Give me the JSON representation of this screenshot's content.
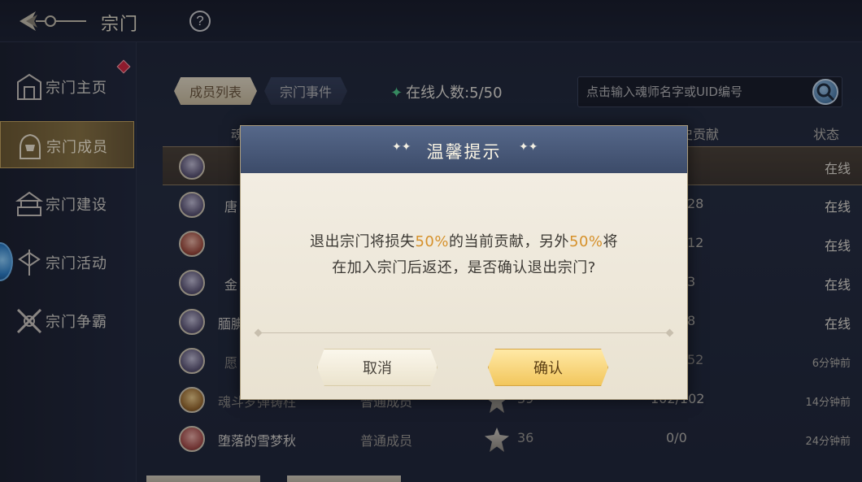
{
  "topbar": {
    "title": "宗门",
    "help_label": "?"
  },
  "sidebar": {
    "items": [
      {
        "label": "宗门主页",
        "icon": "sect-home-icon"
      },
      {
        "label": "宗门成员",
        "icon": "sect-members-icon"
      },
      {
        "label": "宗门建设",
        "icon": "sect-build-icon"
      },
      {
        "label": "宗门活动",
        "icon": "sect-activity-icon"
      },
      {
        "label": "宗门争霸",
        "icon": "sect-battle-icon"
      }
    ],
    "active_index": 1
  },
  "tabs": {
    "members": "成员列表",
    "events": "宗门事件"
  },
  "online": {
    "label": "在线人数:5/50"
  },
  "search": {
    "placeholder": "点击输入魂师名字或UID编号"
  },
  "table": {
    "headers": {
      "name_partial": "魂",
      "contribution_partial": "史贡献",
      "status": "状态"
    },
    "rows": [
      {
        "name": "",
        "role": "",
        "level": "",
        "contribution": "",
        "status": "在线",
        "selected": true
      },
      {
        "name": "唐",
        "role": "",
        "level": "",
        "contribution": "28",
        "status": "在线"
      },
      {
        "name": "",
        "role": "",
        "level": "",
        "contribution": "12",
        "status": "在线"
      },
      {
        "name": "金",
        "role": "",
        "level": "",
        "contribution": "3",
        "status": "在线"
      },
      {
        "name": "腼腆",
        "role": "",
        "level": "",
        "contribution": "8",
        "status": "在线"
      },
      {
        "name": "愿",
        "role": "",
        "level": "",
        "contribution": "52",
        "status": "6分钟前"
      },
      {
        "name": "魂斗罗弹铸柱",
        "role": "普通成员",
        "level": "39",
        "contribution": "102/102",
        "status": "14分钟前"
      },
      {
        "name": "堕落的雪梦秋",
        "role": "普通成员",
        "level": "36",
        "contribution": "0/0",
        "status": "24分钟前"
      }
    ]
  },
  "dialog": {
    "title": "温馨提示",
    "msg_line1_a": "退出宗门将损失",
    "msg_line1_b": "50%",
    "msg_line1_c": "的当前贡献，另外",
    "msg_line1_d": "50%",
    "msg_line1_e": "将",
    "msg_line2": "在加入宗门后返还，是否确认退出宗门?",
    "cancel_label": "取消",
    "confirm_label": "确认"
  },
  "colors": {
    "highlight": "#d6912b",
    "accent_gold": "#c8a65c",
    "online_green": "#4fd08a"
  }
}
